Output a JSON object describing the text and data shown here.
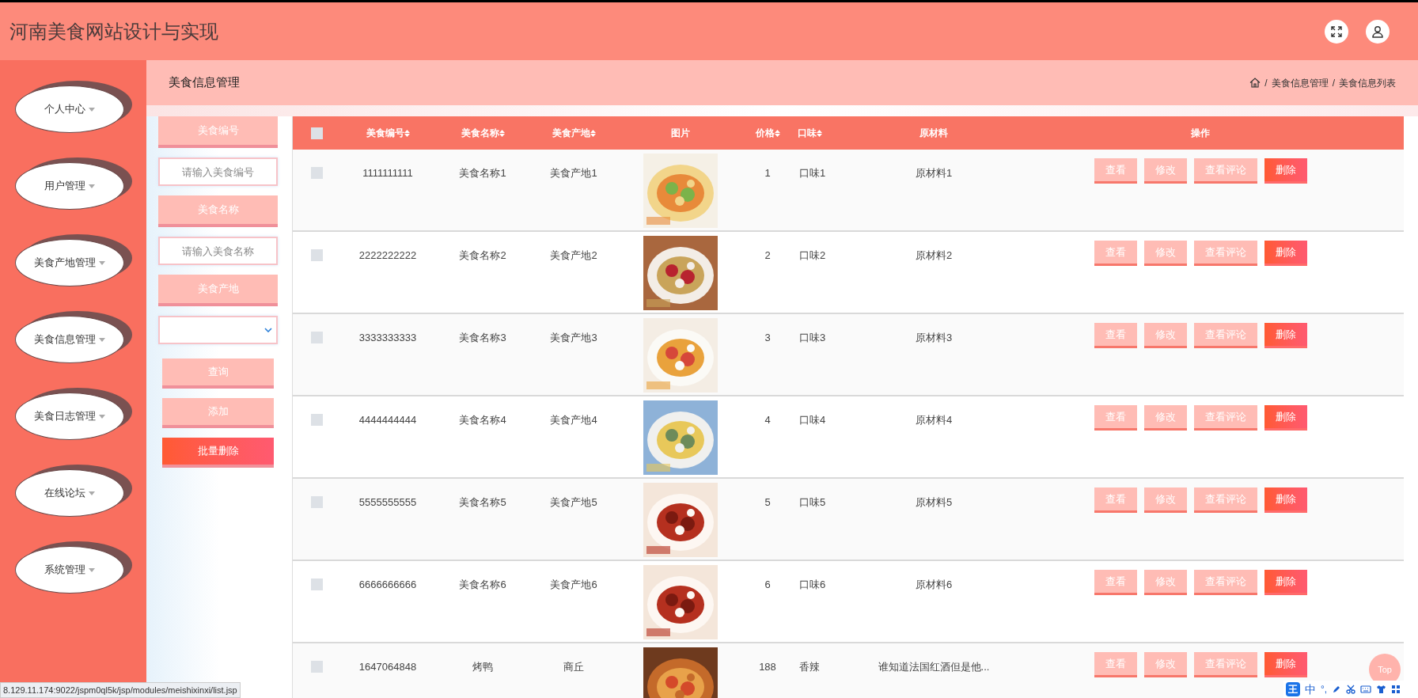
{
  "header": {
    "title": "河南美食网站设计与实现"
  },
  "sidebar": {
    "items": [
      {
        "label": "个人中心"
      },
      {
        "label": "用户管理"
      },
      {
        "label": "美食产地管理"
      },
      {
        "label": "美食信息管理"
      },
      {
        "label": "美食日志管理"
      },
      {
        "label": "在线论坛"
      },
      {
        "label": "系统管理"
      }
    ]
  },
  "breadcrumb": {
    "title": "美食信息管理",
    "path": [
      {
        "separator": "/",
        "label": "美食信息管理"
      },
      {
        "separator": "/",
        "label": "美食信息列表"
      }
    ]
  },
  "filters": {
    "fields": [
      {
        "kind": "label",
        "text": "美食编号"
      },
      {
        "kind": "input",
        "placeholder": "请输入美食编号"
      },
      {
        "kind": "label",
        "text": "美食名称"
      },
      {
        "kind": "input",
        "placeholder": "请输入美食名称"
      },
      {
        "kind": "label",
        "text": "美食产地"
      },
      {
        "kind": "select"
      }
    ],
    "buttons": [
      {
        "label": "查询",
        "kind": "normal"
      },
      {
        "label": "添加",
        "kind": "normal"
      },
      {
        "label": "批量删除",
        "kind": "danger"
      }
    ]
  },
  "table": {
    "select_all": {
      "checked": false
    },
    "columns": [
      {
        "label": "美食编号",
        "sortable": true
      },
      {
        "label": "美食名称",
        "sortable": true
      },
      {
        "label": "美食产地",
        "sortable": true
      },
      {
        "label": "图片",
        "sortable": false
      },
      {
        "label": "价格",
        "sortable": true
      },
      {
        "label": "口味",
        "sortable": true
      },
      {
        "label": "原材料",
        "sortable": false
      },
      {
        "label": "操作",
        "sortable": false
      }
    ],
    "rows": [
      {
        "checked": false,
        "cells": [
          "1111111111",
          "美食名称1",
          "美食产地1",
          {
            "kind": "picture"
          },
          "1",
          "口味1",
          "原材料1"
        ],
        "actions": [
          {
            "label": "查看",
            "kind": "normal"
          },
          {
            "label": "修改",
            "kind": "normal"
          },
          {
            "label": "查看评论",
            "kind": "normal"
          },
          {
            "label": "删除",
            "kind": "danger"
          }
        ]
      },
      {
        "checked": false,
        "cells": [
          "2222222222",
          "美食名称2",
          "美食产地2",
          {
            "kind": "picture"
          },
          "2",
          "口味2",
          "原材料2"
        ],
        "actions": [
          {
            "label": "查看",
            "kind": "normal"
          },
          {
            "label": "修改",
            "kind": "normal"
          },
          {
            "label": "查看评论",
            "kind": "normal"
          },
          {
            "label": "删除",
            "kind": "danger"
          }
        ]
      },
      {
        "checked": false,
        "cells": [
          "3333333333",
          "美食名称3",
          "美食产地3",
          {
            "kind": "picture"
          },
          "3",
          "口味3",
          "原材料3"
        ],
        "actions": [
          {
            "label": "查看",
            "kind": "normal"
          },
          {
            "label": "修改",
            "kind": "normal"
          },
          {
            "label": "查看评论",
            "kind": "normal"
          },
          {
            "label": "删除",
            "kind": "danger"
          }
        ]
      },
      {
        "checked": false,
        "cells": [
          "4444444444",
          "美食名称4",
          "美食产地4",
          {
            "kind": "picture"
          },
          "4",
          "口味4",
          "原材料4"
        ],
        "actions": [
          {
            "label": "查看",
            "kind": "normal"
          },
          {
            "label": "修改",
            "kind": "normal"
          },
          {
            "label": "查看评论",
            "kind": "normal"
          },
          {
            "label": "删除",
            "kind": "danger"
          }
        ]
      },
      {
        "checked": false,
        "cells": [
          "5555555555",
          "美食名称5",
          "美食产地5",
          {
            "kind": "picture"
          },
          "5",
          "口味5",
          "原材料5"
        ],
        "actions": [
          {
            "label": "查看",
            "kind": "normal"
          },
          {
            "label": "修改",
            "kind": "normal"
          },
          {
            "label": "查看评论",
            "kind": "normal"
          },
          {
            "label": "删除",
            "kind": "danger"
          }
        ]
      },
      {
        "checked": false,
        "cells": [
          "6666666666",
          "美食名称6",
          "美食产地6",
          {
            "kind": "picture"
          },
          "6",
          "口味6",
          "原材料6"
        ],
        "actions": [
          {
            "label": "查看",
            "kind": "normal"
          },
          {
            "label": "修改",
            "kind": "normal"
          },
          {
            "label": "查看评论",
            "kind": "normal"
          },
          {
            "label": "删除",
            "kind": "danger"
          }
        ]
      },
      {
        "checked": false,
        "cells": [
          "1647064848",
          "烤鸭",
          "商丘",
          {
            "kind": "picture"
          },
          "188",
          "香辣",
          "谁知道法国红酒但是他..."
        ],
        "actions": [
          {
            "label": "查看",
            "kind": "normal"
          },
          {
            "label": "修改",
            "kind": "normal"
          },
          {
            "label": "查看评论",
            "kind": "normal"
          },
          {
            "label": "删除",
            "kind": "danger"
          }
        ]
      }
    ]
  },
  "top_button": {
    "label": "Top"
  },
  "status_url": "8.129.11.174:9022/jspm0ql5k/jsp/modules/meishixinxi/list.jsp",
  "ime_bar": {
    "logo": "王",
    "mode": "中",
    "punctuation": "°,"
  }
}
